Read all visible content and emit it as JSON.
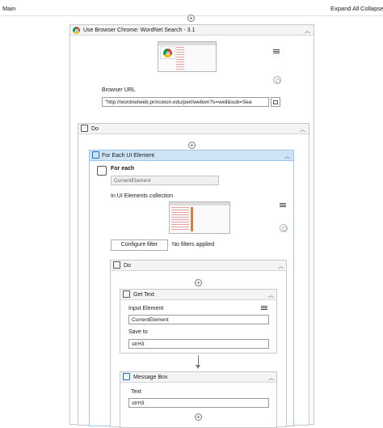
{
  "topbar": {
    "breadcrumb": "Main",
    "expand_all": "Expand All",
    "collapse": "Collapse"
  },
  "browser_scope": {
    "title": "Use Browser Chrome: WordNet Search - 3.1",
    "url_label": "Browser URL",
    "url_value": "\"http://wordnetweb.princeton.edu/perl/webwn?s=well&sub=Sea"
  },
  "do_outer": {
    "title": "Do"
  },
  "for_each": {
    "title": "For Each UI Element",
    "for_each_label": "For each",
    "item_placeholder": "CurrentElement",
    "collection_label": "In UI Elements collection",
    "configure_filter": "Configure filter",
    "filter_status": "No filters applied"
  },
  "do_inner": {
    "title": "Do"
  },
  "get_text": {
    "title": "Get Text",
    "input_label": "Input Element",
    "input_value": "CurrentElement",
    "save_label": "Save to",
    "save_value": "strH3"
  },
  "message_box": {
    "title": "Message Box",
    "text_label": "Text",
    "text_value": "strH3"
  },
  "colors": {
    "selected_header": "#cde4f7",
    "accent": "#1a73c8"
  }
}
